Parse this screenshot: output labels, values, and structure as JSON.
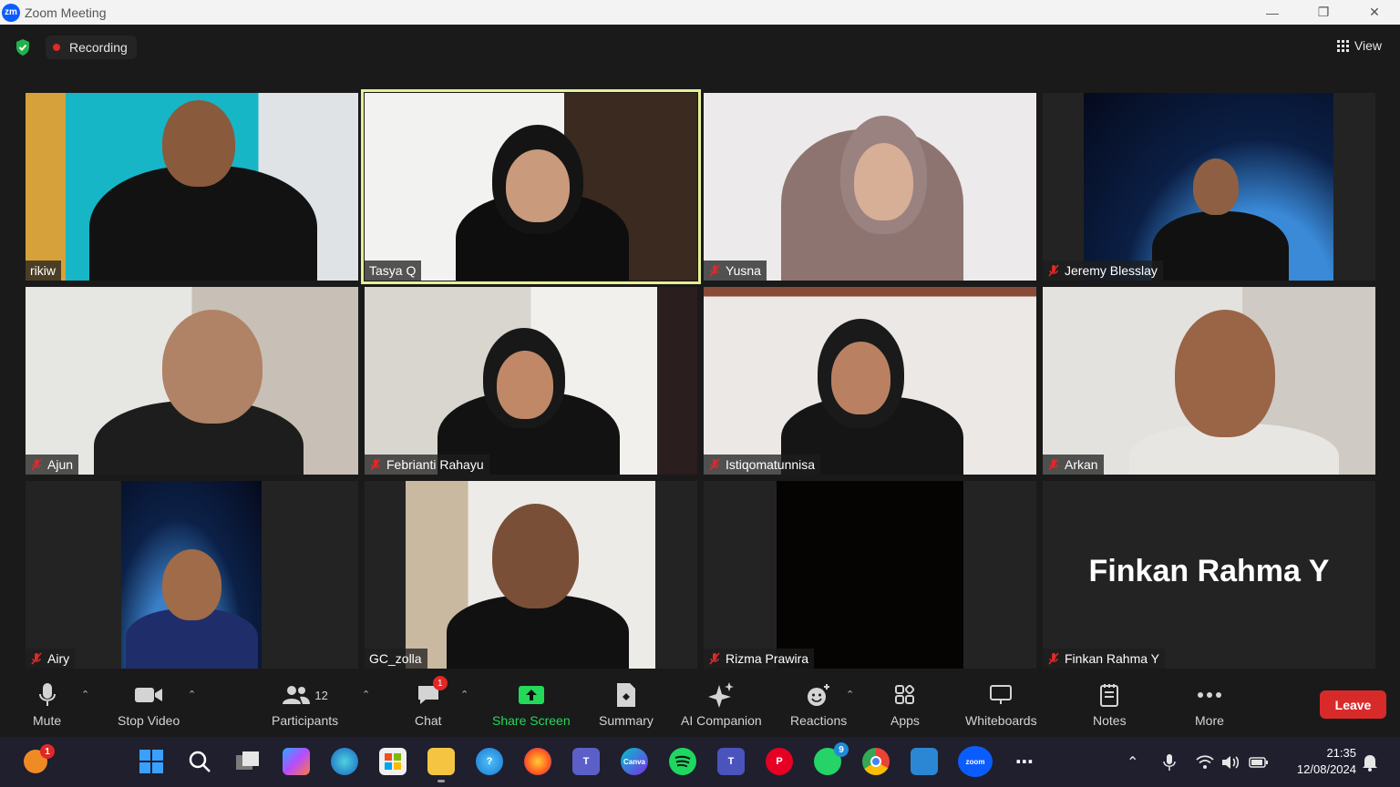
{
  "window": {
    "title": "Zoom Meeting",
    "logo_text": "zm"
  },
  "topbar": {
    "recording_label": "Recording",
    "view_label": "View"
  },
  "participants_tiles": [
    {
      "name": "rikiw",
      "muted": false
    },
    {
      "name": "Tasya Q",
      "muted": false,
      "active_speaker": true
    },
    {
      "name": "Yusna",
      "muted": true
    },
    {
      "name": "Jeremy Blesslay",
      "muted": true
    },
    {
      "name": "Ajun",
      "muted": true
    },
    {
      "name": "Febrianti Rahayu",
      "muted": true
    },
    {
      "name": "Istiqomatunnisa",
      "muted": true
    },
    {
      "name": "Arkan",
      "muted": true
    },
    {
      "name": "Airy",
      "muted": true
    },
    {
      "name": "GC_zolla",
      "muted": false
    },
    {
      "name": "Rizma Prawira",
      "muted": true
    },
    {
      "name": "Finkan Rahma Y",
      "muted": true,
      "video_off_label": "Finkan Rahma Y"
    }
  ],
  "toolbar": {
    "mute": "Mute",
    "stop_video": "Stop Video",
    "participants": "Participants",
    "participants_count": "12",
    "chat": "Chat",
    "chat_badge": "1",
    "share_screen": "Share Screen",
    "summary": "Summary",
    "ai_companion": "AI Companion",
    "reactions": "Reactions",
    "apps": "Apps",
    "whiteboards": "Whiteboards",
    "notes": "Notes",
    "more": "More",
    "leave": "Leave"
  },
  "taskbar": {
    "start_badge": "1",
    "whatsapp_badge": "9",
    "canva_label": "Canva",
    "zoom_label": "zoom",
    "time": "21:35",
    "date": "12/08/2024"
  },
  "colors": {
    "accent_green": "#23d959",
    "leave_red": "#d92a2a",
    "active_border": "#e8ef94",
    "zoom_blue": "#0b5cff"
  }
}
